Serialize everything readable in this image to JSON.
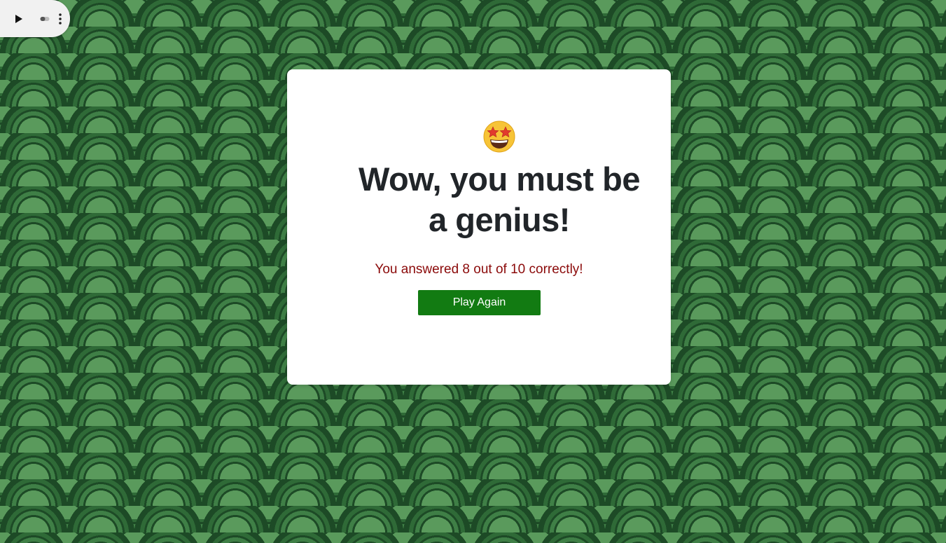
{
  "media_controls": {
    "icons": [
      "play-icon",
      "toggle-icon",
      "more-vertical-icon"
    ]
  },
  "result_card": {
    "emoji": "star-struck-emoji",
    "headline": "Wow, you must be a genius!",
    "result_text": "You answered 8 out of 10 correctly!",
    "score": 8,
    "total": 10,
    "play_again_label": "Play Again"
  },
  "colors": {
    "background_pattern_dark": "#1d4a26",
    "background_pattern_light": "#5a9a5c",
    "headline": "#212529",
    "result_text": "#8b0a0a",
    "button": "#127b12",
    "button_text": "#ffffff"
  }
}
